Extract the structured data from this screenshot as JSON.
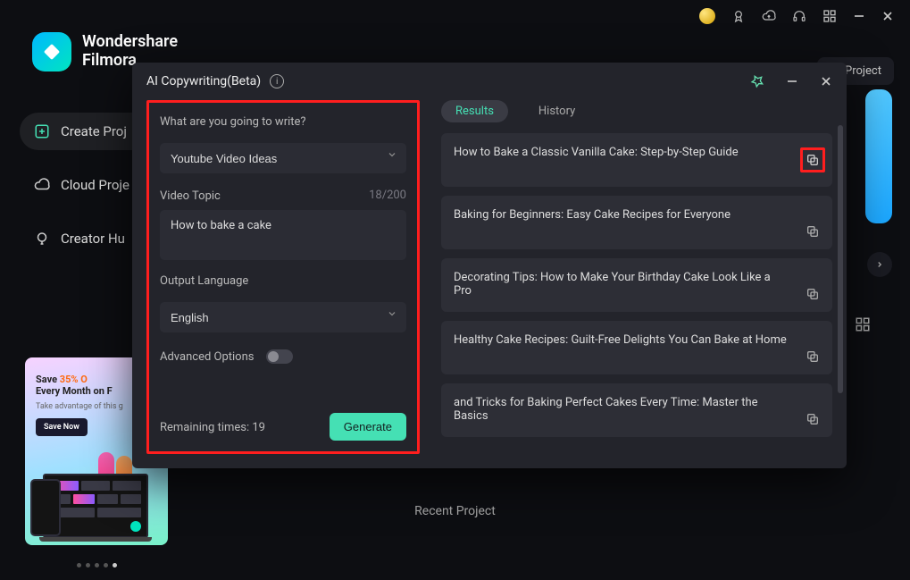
{
  "brand": {
    "line1": "Wondershare",
    "line2": "Filmora"
  },
  "nav": {
    "create": "Create Proj",
    "cloud": "Cloud Proje",
    "hub": "Creator Hu"
  },
  "promo": {
    "save_prefix": "Save ",
    "save_pct": "35% O",
    "line2": "Every Month on F",
    "sub": "Take advantage of this g",
    "cta": "Save Now"
  },
  "open_project": "en Project",
  "recent_project": "Recent Project",
  "modal": {
    "title": "AI Copywriting(Beta)",
    "prompt_label": "What are you going to write?",
    "write_type": "Youtube Video Ideas",
    "video_topic_label": "Video Topic",
    "video_topic_counter": "18/200",
    "video_topic_value": "How to bake a cake",
    "lang_label": "Output Language",
    "lang_value": "English",
    "advanced_label": "Advanced Options",
    "remaining": "Remaining times: 19",
    "generate": "Generate",
    "tabs": {
      "results": "Results",
      "history": "History"
    },
    "results": [
      "How to Bake a Classic Vanilla Cake: Step-by-Step Guide",
      "Baking for Beginners: Easy Cake Recipes for Everyone",
      "Decorating Tips: How to Make Your Birthday Cake Look Like a Pro",
      "Healthy Cake Recipes: Guilt-Free Delights You Can Bake at Home",
      "and Tricks for Baking Perfect Cakes Every Time: Master the Basics"
    ]
  }
}
